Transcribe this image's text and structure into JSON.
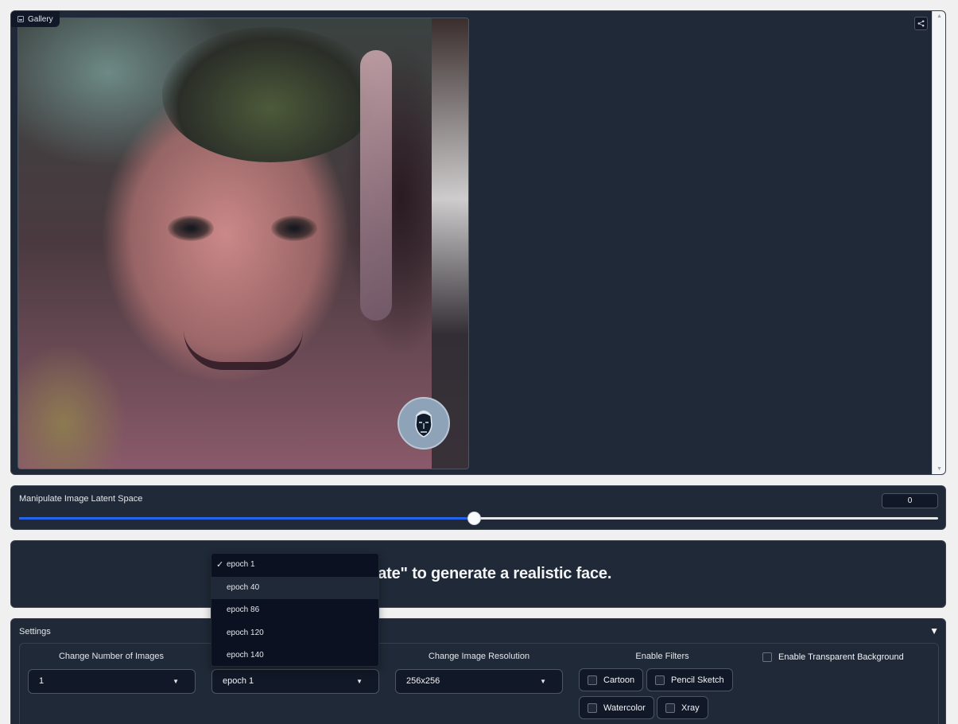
{
  "gallery": {
    "label": "Gallery",
    "share_icon": "share-icon",
    "scroll_up": "▲",
    "scroll_down": "▼"
  },
  "latent_slider": {
    "label": "Manipulate Image Latent Space",
    "value": "0",
    "fill_fraction": 0.495
  },
  "instruction": {
    "visible_text": "enerate\" to generate a realistic face."
  },
  "settings": {
    "title": "Settings",
    "collapse_icon": "▼",
    "num_images": {
      "label": "Change Number of Images",
      "value": "1"
    },
    "epoch": {
      "value": "epoch 1"
    },
    "resolution": {
      "label": "Change Image Resolution",
      "value": "256x256"
    },
    "filters": {
      "label": "Enable Filters",
      "options": [
        "Cartoon",
        "Pencil Sketch",
        "Watercolor",
        "Xray"
      ]
    },
    "transparent_bg": {
      "label": "Enable Transparent Background"
    }
  },
  "epoch_dropdown": {
    "check_mark": "✓",
    "options": [
      "epoch 1",
      "epoch 40",
      "epoch 86",
      "epoch 120",
      "epoch 140"
    ],
    "selected": "epoch 1",
    "highlighted": "epoch 40"
  },
  "colors": {
    "panel_bg": "#1f2937",
    "page_bg": "#f0f0f0",
    "accent": "#2563eb",
    "dropdown_bg": "#0b1120"
  }
}
